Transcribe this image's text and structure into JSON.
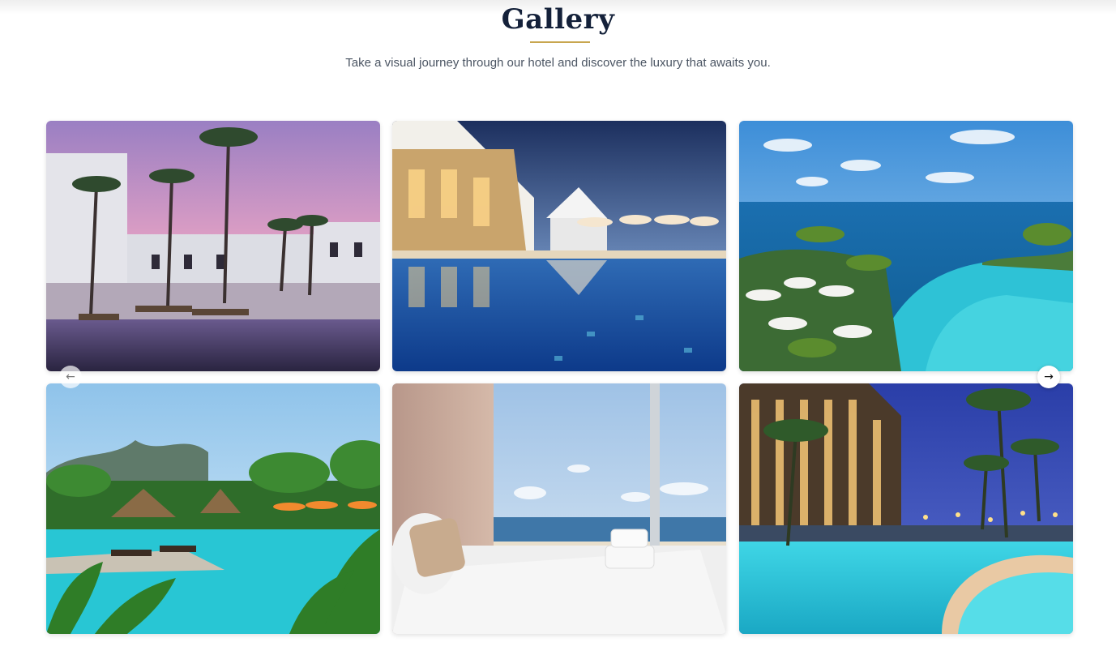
{
  "section": {
    "title": "Gallery",
    "subtitle": "Take a visual journey through our hotel and discover the luxury that awaits you."
  },
  "carousel": {
    "prev_icon": "arrow-left-icon",
    "next_icon": "arrow-right-icon",
    "prev_glyph": "←",
    "next_glyph": "→"
  },
  "colors": {
    "title": "#14213a",
    "accent": "#c8a64f",
    "subtitle": "#4b5563"
  },
  "gallery": [
    {
      "scene": "sunset-pool-palms"
    },
    {
      "scene": "night-pool-restaurant"
    },
    {
      "scene": "infinity-pool-ocean"
    },
    {
      "scene": "tropical-pool-villas"
    },
    {
      "scene": "bedroom-ocean-view"
    },
    {
      "scene": "night-resort-pool"
    }
  ]
}
